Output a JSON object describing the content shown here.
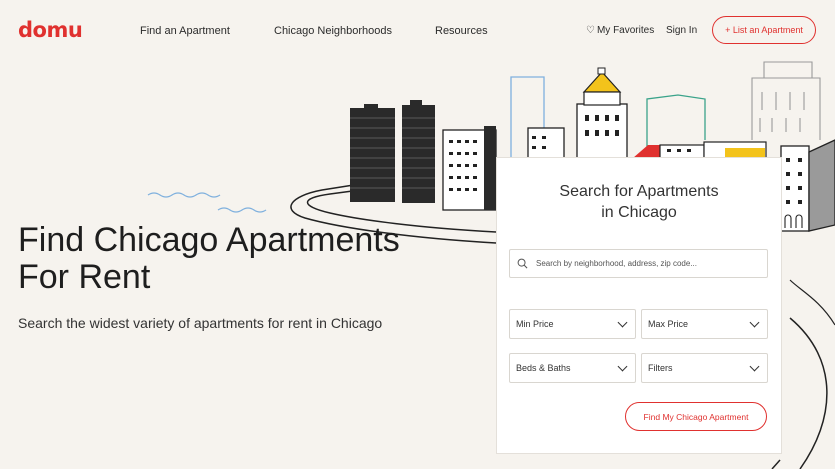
{
  "brand": {
    "logo": "domu",
    "accent": "#e0312f"
  },
  "nav": {
    "find_apartment": "Find an Apartment",
    "neighborhoods": "Chicago Neighborhoods",
    "resources": "Resources",
    "favorites": "My Favorites",
    "sign_in": "Sign In",
    "list_apartment": "+ List an Apartment"
  },
  "hero": {
    "title": "Find Chicago Apartments For Rent",
    "subtitle": "Search the widest variety of apartments for rent in Chicago"
  },
  "search_card": {
    "title_line1": "Search for Apartments",
    "title_line2": "in Chicago",
    "search_placeholder": "Search by neighborhood, address, zip code...",
    "min_price": "Min Price",
    "max_price": "Max Price",
    "beds_baths": "Beds & Baths",
    "filters": "Filters",
    "submit": "Find My Chicago Apartment"
  },
  "icons": [
    "heart-icon",
    "search-icon",
    "chevron-down-icon"
  ]
}
